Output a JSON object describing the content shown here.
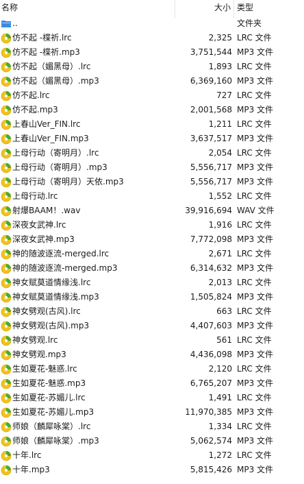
{
  "header": {
    "name": "名称",
    "size": "大小",
    "type": "类型"
  },
  "rows": [
    {
      "name": "..",
      "size": "",
      "type": "文件夹",
      "icon": "folder-up-icon"
    },
    {
      "name": "仿不起 -楪祈.lrc",
      "size": "2,325",
      "type": "LRC 文件",
      "icon": "media-file-icon"
    },
    {
      "name": "仿不起 -楪祈.mp3",
      "size": "3,751,544",
      "type": "MP3 文件",
      "icon": "media-file-icon"
    },
    {
      "name": "仿不起（媚黑母）.lrc",
      "size": "1,893",
      "type": "LRC 文件",
      "icon": "media-file-icon"
    },
    {
      "name": "仿不起（媚黑母）.mp3",
      "size": "6,369,160",
      "type": "MP3 文件",
      "icon": "media-file-icon"
    },
    {
      "name": "仿不起.lrc",
      "size": "727",
      "type": "LRC 文件",
      "icon": "media-file-icon"
    },
    {
      "name": "仿不起.mp3",
      "size": "2,001,568",
      "type": "MP3 文件",
      "icon": "media-file-icon"
    },
    {
      "name": "上春山Ver_FIN.lrc",
      "size": "1,211",
      "type": "LRC 文件",
      "icon": "media-file-icon"
    },
    {
      "name": "上春山Ver_FIN.mp3",
      "size": "3,637,517",
      "type": "MP3 文件",
      "icon": "media-file-icon"
    },
    {
      "name": "上母行动（寄明月）.lrc",
      "size": "2,054",
      "type": "LRC 文件",
      "icon": "media-file-icon"
    },
    {
      "name": "上母行动（寄明月）.mp3",
      "size": "5,556,717",
      "type": "MP3 文件",
      "icon": "media-file-icon"
    },
    {
      "name": "上母行动（寄明月）天依.mp3",
      "size": "5,556,717",
      "type": "MP3 文件",
      "icon": "media-file-icon"
    },
    {
      "name": "上母行动.lrc",
      "size": "1,552",
      "type": "LRC 文件",
      "icon": "media-file-icon"
    },
    {
      "name": "射爆BAAM！.wav",
      "size": "39,916,694",
      "type": "WAV 文件",
      "icon": "media-file-icon"
    },
    {
      "name": "深夜女武神.lrc",
      "size": "1,916",
      "type": "LRC 文件",
      "icon": "media-file-icon"
    },
    {
      "name": "深夜女武神.mp3",
      "size": "7,772,098",
      "type": "MP3 文件",
      "icon": "media-file-icon"
    },
    {
      "name": "神的随波逐流-merged.lrc",
      "size": "2,671",
      "type": "LRC 文件",
      "icon": "media-file-icon"
    },
    {
      "name": "神的随波逐流-merged.mp3",
      "size": "6,314,632",
      "type": "MP3 文件",
      "icon": "media-file-icon"
    },
    {
      "name": "神女赋莫道情缘浅.lrc",
      "size": "2,013",
      "type": "LRC 文件",
      "icon": "media-file-icon"
    },
    {
      "name": "神女赋莫道情缘浅.mp3",
      "size": "1,505,824",
      "type": "MP3 文件",
      "icon": "media-file-icon"
    },
    {
      "name": "神女劈观(古风).lrc",
      "size": "663",
      "type": "LRC 文件",
      "icon": "media-file-icon"
    },
    {
      "name": "神女劈观(古风).mp3",
      "size": "4,407,603",
      "type": "MP3 文件",
      "icon": "media-file-icon"
    },
    {
      "name": "神女劈观.lrc",
      "size": "561",
      "type": "LRC 文件",
      "icon": "media-file-icon"
    },
    {
      "name": "神女劈观.mp3",
      "size": "4,436,098",
      "type": "MP3 文件",
      "icon": "media-file-icon"
    },
    {
      "name": "生如夏花-魅惑.lrc",
      "size": "2,120",
      "type": "LRC 文件",
      "icon": "media-file-icon"
    },
    {
      "name": "生如夏花-魅惑.mp3",
      "size": "6,765,207",
      "type": "MP3 文件",
      "icon": "media-file-icon"
    },
    {
      "name": "生如夏花-苏媚儿.lrc",
      "size": "1,491",
      "type": "LRC 文件",
      "icon": "media-file-icon"
    },
    {
      "name": "生如夏花-苏媚儿.mp3",
      "size": "11,970,385",
      "type": "MP3 文件",
      "icon": "media-file-icon"
    },
    {
      "name": "师娘（麟犀咏棠）.lrc",
      "size": "1,334",
      "type": "LRC 文件",
      "icon": "media-file-icon"
    },
    {
      "name": "师娘（麟犀咏棠）.mp3",
      "size": "5,062,574",
      "type": "MP3 文件",
      "icon": "media-file-icon"
    },
    {
      "name": "十年.lrc",
      "size": "1,272",
      "type": "LRC 文件",
      "icon": "media-file-icon"
    },
    {
      "name": "十年.mp3",
      "size": "5,815,426",
      "type": "MP3 文件",
      "icon": "media-file-icon"
    }
  ],
  "colors": {
    "icon_yellow": "#f2c21a",
    "icon_green": "#3dae3a",
    "icon_disc": "#ffffff",
    "folder_blue": "#3a8de0"
  }
}
